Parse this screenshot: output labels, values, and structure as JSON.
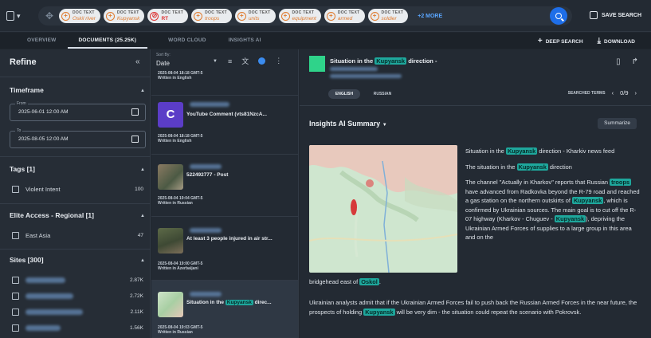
{
  "search": {
    "doc_menu_caret": "▾",
    "chips": [
      {
        "type": "DOC TEXT",
        "value": "Oskil river",
        "excluded": false
      },
      {
        "type": "DOC TEXT",
        "value": "Kupyansk",
        "excluded": false
      },
      {
        "type": "DOC TEXT",
        "value": "RT",
        "excluded": true
      },
      {
        "type": "DOC TEXT",
        "value": "troops",
        "excluded": false
      },
      {
        "type": "DOC TEXT",
        "value": "units",
        "excluded": false
      },
      {
        "type": "DOC TEXT",
        "value": "equipment",
        "excluded": false
      },
      {
        "type": "DOC TEXT",
        "value": "armed",
        "excluded": false
      },
      {
        "type": "DOC TEXT",
        "value": "soldier",
        "excluded": false
      }
    ],
    "more_label": "+2 MORE",
    "save_label": "SAVE SEARCH"
  },
  "tabs": {
    "items": [
      "OVERVIEW",
      "DOCUMENTS (25.25K)",
      "WORD CLOUD",
      "INSIGHTS AI"
    ],
    "active_index": 1,
    "deep_search": "DEEP SEARCH",
    "download": "DOWNLOAD"
  },
  "refine": {
    "title": "Refine",
    "timeframe": {
      "heading": "Timeframe",
      "from_label": "From",
      "from_value": "2025-06-01 12:00 AM",
      "to_label": "To",
      "to_value": "2025-08-05 12:00 AM"
    },
    "tags": {
      "heading": "Tags [1]",
      "items": [
        {
          "label": "Violent Intent",
          "count": "100"
        }
      ]
    },
    "elite": {
      "heading": "Elite Access - Regional [1]",
      "items": [
        {
          "label": "East Asia",
          "count": "47"
        }
      ]
    },
    "sites": {
      "heading": "Sites [300]",
      "counts": [
        "2.87K",
        "2.72K",
        "2.11K",
        "1.56K"
      ]
    }
  },
  "list": {
    "sort_label": "Sort By:",
    "sort_value": "Date",
    "items": [
      {
        "title": "",
        "meta1": "2025-08-04 18:18 GMT-5",
        "meta2": "Written in English"
      },
      {
        "title": "YouTube Comment (vts81NzcA...",
        "meta1": "2025-08-04 18:18 GMT-5",
        "meta2": "Written in English",
        "avatar": "C"
      },
      {
        "title": "522492777 - Post",
        "meta1": "2025-08-04 19:04 GMT-5",
        "meta2": "Written in Russian"
      },
      {
        "title": "At least 3 people injured in air str...",
        "meta1": "2025-08-04 19:00 GMT-5",
        "meta2": "Written in Azerbaijani"
      },
      {
        "title_pre": "Situation in the ",
        "title_kw": "Kupyansk",
        "title_post": " direc...",
        "meta1": "2025-08-04 19:03 GMT-5",
        "meta2": "Written in Russian"
      }
    ]
  },
  "reader": {
    "title_pre": "Situation in the ",
    "title_kw": "Kupyansk",
    "title_post": " direction -",
    "lang_active": "ENGLISH",
    "lang_other": "RUSSIAN",
    "searched_terms": "SEARCHED TERMS",
    "term_counter": "0/9",
    "summary_title": "Insights AI Summary",
    "summarize_label": "Summarize",
    "p1_pre": "Situation in the ",
    "p1_kw": "Kupyansk",
    "p1_post": " direction - Kharkiv news feed",
    "p2_pre": "The situation in the ",
    "p2_kw": "Kupyansk",
    "p2_post": " direction",
    "p3_a": "The channel \"Actually in Kharkov\" reports that Russian ",
    "p3_kw1": "troops",
    "p3_b": " have advanced from Radkovka beyond the R-79 road and reached a gas station on the northern outskirts of ",
    "p3_kw2": "Kupyansk",
    "p3_c": ", which is confirmed by Ukrainian sources. The main goal is to cut off the R-07 highway (Kharkov - Chuguev - ",
    "p3_kw3": "Kupyansk",
    "p3_d": "), depriving the Ukrainian Armed Forces of supplies to a large group in this area and on the",
    "p4_a": "bridgehead east of ",
    "p4_kw": "Oskol",
    "p4_b": ".",
    "p5_a": "Ukrainian analysts admit that if the Ukrainian Armed Forces fail to push back the Russian Armed Forces in the near future, the prospects of holding ",
    "p5_kw": "Kupyansk",
    "p5_b": " will be very dim - the situation could repeat the scenario with Pokrovsk."
  }
}
